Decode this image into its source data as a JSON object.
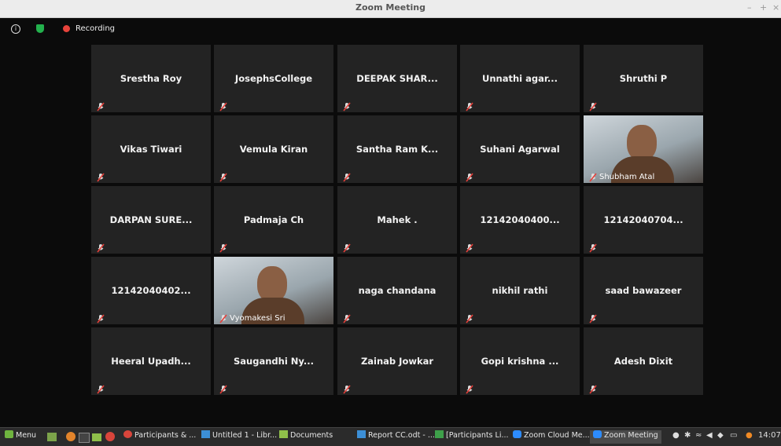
{
  "window": {
    "title": "Zoom Meeting",
    "controls": [
      "–",
      "+",
      "×"
    ]
  },
  "topbar": {
    "recording_label": "Recording"
  },
  "participants": [
    {
      "name": "Srestha Roy"
    },
    {
      "name": "JosephsCollege"
    },
    {
      "name": "DEEPAK SHAR..."
    },
    {
      "name": "Unnathi agar..."
    },
    {
      "name": "Shruthi P"
    },
    {
      "name": "Vikas Tiwari"
    },
    {
      "name": "Vemula Kiran"
    },
    {
      "name": "Santha Ram K..."
    },
    {
      "name": "Suhani Agarwal"
    },
    {
      "name": "Shubham Atal",
      "video": true
    },
    {
      "name": "DARPAN SURE..."
    },
    {
      "name": "Padmaja Ch"
    },
    {
      "name": "Mahek ."
    },
    {
      "name": "12142040400..."
    },
    {
      "name": "12142040704..."
    },
    {
      "name": "12142040402..."
    },
    {
      "name": "Vyomakesi Sri",
      "video": true,
      "active": true
    },
    {
      "name": "naga chandana"
    },
    {
      "name": "nikhil rathi"
    },
    {
      "name": "saad bawazeer"
    },
    {
      "name": "Heeral Upadh..."
    },
    {
      "name": "Saugandhi Ny..."
    },
    {
      "name": "Zainab Jowkar"
    },
    {
      "name": "Gopi krishna ..."
    },
    {
      "name": "Adesh Dixit"
    }
  ],
  "taskbar": {
    "menu": "Menu",
    "windows": [
      "Participants & ...",
      "Untitled 1 - Libr...",
      "Documents",
      "Report CC.odt - ...",
      "[Participants Li...",
      "Zoom Cloud Me...",
      "Zoom Meeting"
    ],
    "clock": "14:07"
  }
}
